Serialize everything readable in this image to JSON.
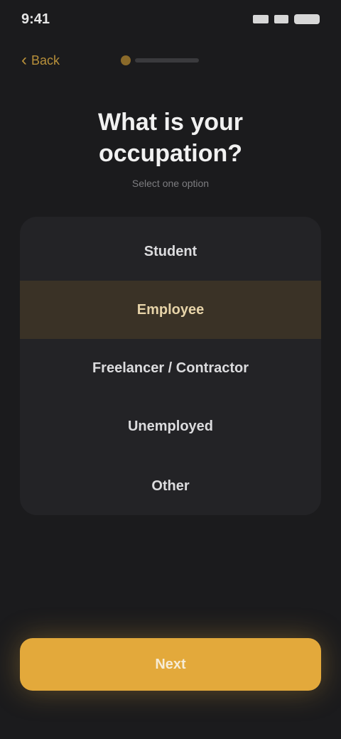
{
  "status_bar": {
    "time": "9:41"
  },
  "header": {
    "back_label": "Back"
  },
  "question": {
    "title": "What is your occupation?",
    "subtitle": "Select one option"
  },
  "options": [
    {
      "label": "Student",
      "selected": false
    },
    {
      "label": "Employee",
      "selected": true
    },
    {
      "label": "Freelancer / Contractor",
      "selected": false
    },
    {
      "label": "Unemployed",
      "selected": false
    },
    {
      "label": "Other",
      "selected": false
    }
  ],
  "cta": {
    "label": "Next"
  },
  "colors": {
    "accent": "#e3a93b",
    "background": "#1b1b1d",
    "card": "#232326",
    "selected": "#3a3226"
  }
}
